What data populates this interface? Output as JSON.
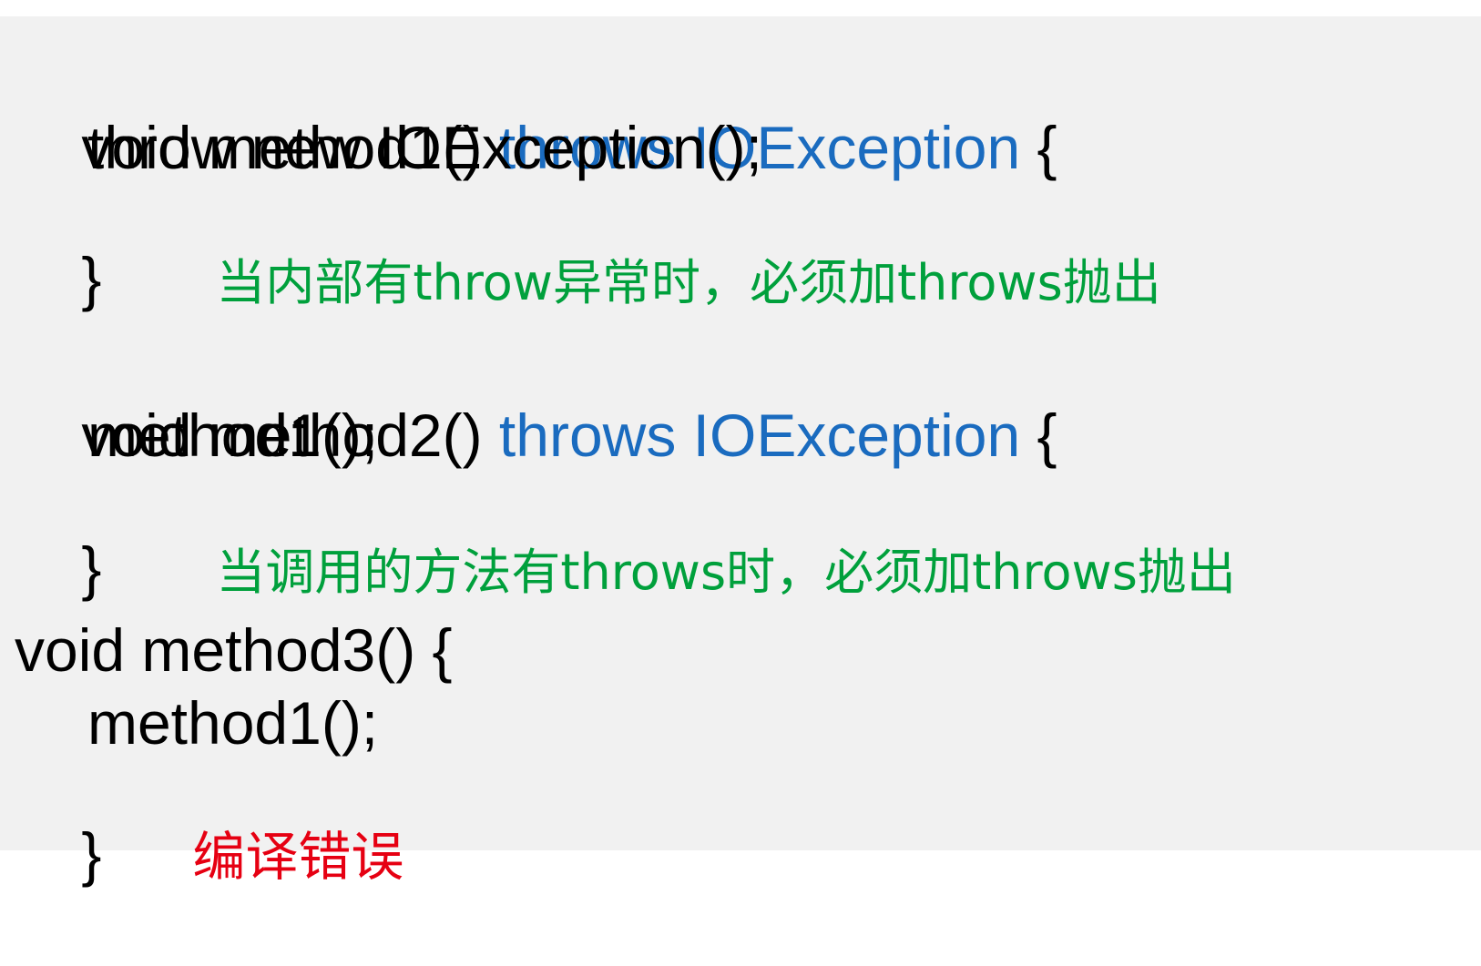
{
  "block1": {
    "sig_plain": "void method1() ",
    "sig_throws": "throws IOException",
    "sig_open": " {",
    "body": "throw new IOException();",
    "close": "}",
    "note": "当内部有throw异常时，必须加throws抛出"
  },
  "block2": {
    "sig_plain": "void method2() ",
    "sig_throws": "throws IOException",
    "sig_open": " {",
    "body": "method1();",
    "close": "}",
    "note": "当调用的方法有throws时，必须加throws抛出"
  },
  "block3": {
    "sig_plain": "void method3() {",
    "body": "method1();",
    "close": "}",
    "error": "编译错误"
  },
  "colors": {
    "code": "#000000",
    "keyword": "#1a6bbf",
    "note": "#00a03c",
    "error": "#e60012",
    "background": "#f1f1f1"
  }
}
